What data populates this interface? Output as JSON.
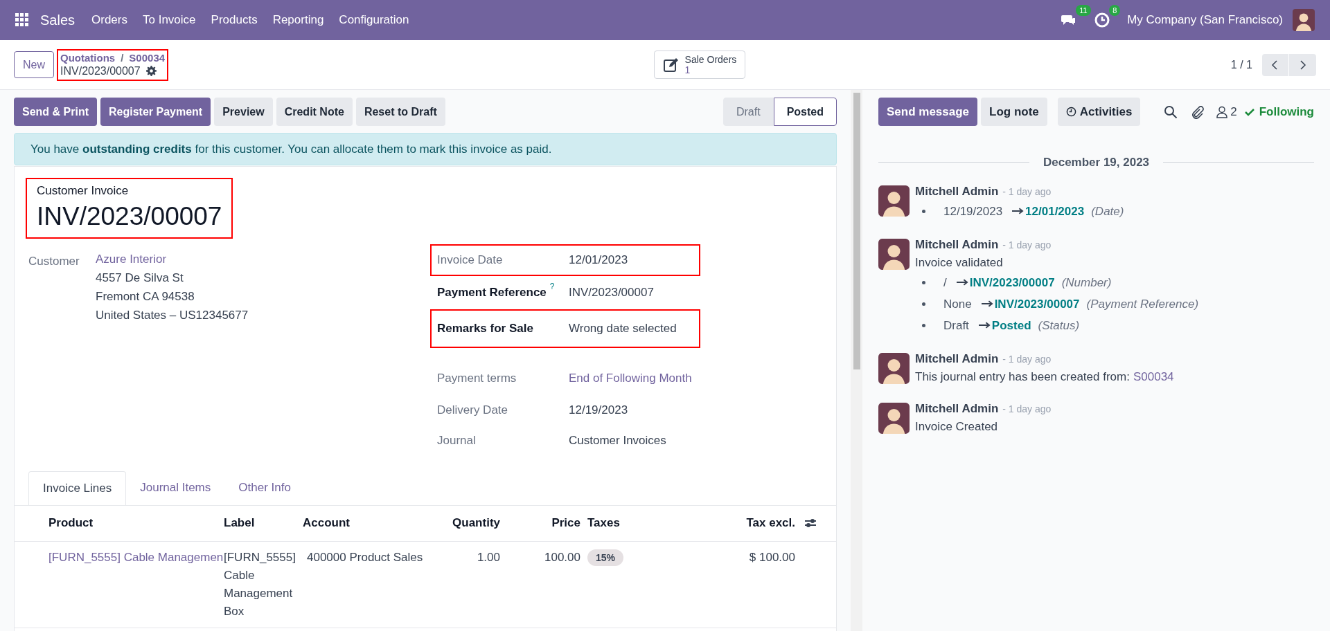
{
  "navbar": {
    "app": "Sales",
    "menu": [
      "Orders",
      "To Invoice",
      "Products",
      "Reporting",
      "Configuration"
    ],
    "messages_badge": "11",
    "activities_badge": "8",
    "company": "My Company (San Francisco)"
  },
  "control_panel": {
    "new_button": "New",
    "breadcrumb": [
      "Quotations",
      "S00034"
    ],
    "breadcrumb_separator": "/",
    "record": "INV/2023/00007",
    "breadcrumb_highlighted": true,
    "smart_button": {
      "label": "Sale Orders",
      "count": "1"
    },
    "pager": "1 / 1"
  },
  "actions": [
    {
      "label": "Send & Print",
      "kind": "primary"
    },
    {
      "label": "Register Payment",
      "kind": "primary"
    },
    {
      "label": "Preview",
      "kind": "secondary"
    },
    {
      "label": "Credit Note",
      "kind": "secondary"
    },
    {
      "label": "Reset to Draft",
      "kind": "secondary"
    }
  ],
  "status_steps": [
    {
      "label": "Draft",
      "selected": false
    },
    {
      "label": "Posted",
      "selected": true
    }
  ],
  "alert": "You have **outstanding credits** for this customer. You can allocate them to mark this invoice as paid.",
  "form": {
    "type_label": "Customer Invoice",
    "number": "INV/2023/00007",
    "title_highlighted": true,
    "customer": {
      "label": "Customer",
      "name": "Azure Interior",
      "address": [
        "4557 De Silva St",
        "Fremont CA 94538",
        "United States – US12345677"
      ]
    },
    "fields": [
      {
        "label": "Invoice Date",
        "value": "12/01/2023",
        "bold": false,
        "link": false,
        "highlighted": true
      },
      {
        "label": "Payment Reference",
        "value": "INV/2023/00007",
        "bold": true,
        "link": false,
        "help": "?",
        "highlighted": false
      },
      {
        "label": "Remarks for Sale",
        "value": "Wrong date selected",
        "bold": true,
        "link": false,
        "highlighted": true
      },
      {
        "label": "Payment terms",
        "value": "End of Following Month",
        "bold": false,
        "link": true,
        "highlighted": false
      },
      {
        "label": "Delivery Date",
        "value": "12/19/2023",
        "bold": false,
        "link": false,
        "highlighted": false
      },
      {
        "label": "Journal",
        "value": "Customer Invoices",
        "bold": false,
        "link": false,
        "highlighted": false
      }
    ]
  },
  "tabs": [
    {
      "label": "Invoice Lines",
      "selected": true
    },
    {
      "label": "Journal Items",
      "selected": false
    },
    {
      "label": "Other Info",
      "selected": false
    }
  ],
  "table": {
    "columns": [
      "Product",
      "Label",
      "Account",
      "Quantity",
      "Price",
      "Taxes",
      "Tax excl."
    ],
    "rows": [
      {
        "product": "[FURN_5555] Cable Managemen",
        "label": [
          "[FURN_5555]",
          "Cable",
          "Management",
          "Box"
        ],
        "account": "400000 Product Sales",
        "quantity": "1.00",
        "price": "100.00",
        "taxes": "15%",
        "tax_excl": "$ 100.00"
      }
    ]
  },
  "chatter": {
    "buttons": [
      {
        "label": "Send message",
        "kind": "primary"
      },
      {
        "label": "Log note",
        "kind": "secondary"
      },
      {
        "label": "Activities",
        "kind": "activities"
      }
    ],
    "followers": "2",
    "following": "Following",
    "date": "December 19, 2023",
    "messages": [
      {
        "author": "Mitchell Admin",
        "time": "- 1 day ago",
        "changes": [
          {
            "from": "12/19/2023",
            "to": "12/01/2023",
            "field": "(Date)"
          }
        ]
      },
      {
        "author": "Mitchell Admin",
        "time": "- 1 day ago",
        "body": "Invoice validated",
        "changes": [
          {
            "from": "/",
            "to": "INV/2023/00007",
            "field": "(Number)"
          },
          {
            "from": "None",
            "to": "INV/2023/00007",
            "field": "(Payment Reference)"
          },
          {
            "from": "Draft",
            "to": "Posted",
            "field": "(Status)"
          }
        ]
      },
      {
        "author": "Mitchell Admin",
        "time": "- 1 day ago",
        "body": "This journal entry has been created from:",
        "link": "S00034"
      },
      {
        "author": "Mitchell Admin",
        "time": "- 1 day ago",
        "body": "Invoice Created"
      }
    ]
  }
}
